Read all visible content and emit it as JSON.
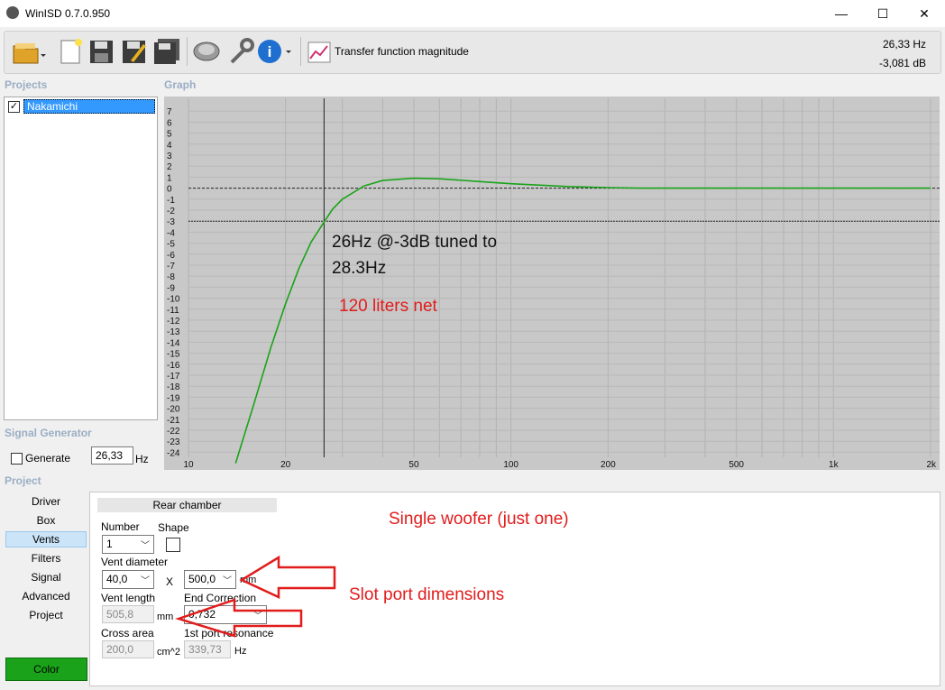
{
  "window": {
    "title": "WinISD 0.7.0.950",
    "minimize": "—",
    "maximize": "☐",
    "close": "✕"
  },
  "toolbar": {
    "graph_label": "Transfer function magnitude",
    "cursor_hz": "26,33 Hz",
    "cursor_db": "-3,081 dB",
    "icons": [
      "open-folder-icon",
      "new-document-icon",
      "save-icon",
      "save-as-icon",
      "save-all-icon",
      "driver-icon",
      "wrench-icon",
      "info-icon",
      "graph-icon"
    ]
  },
  "projects": {
    "heading": "Projects",
    "items": [
      {
        "label": "Nakamichi",
        "checked": true
      }
    ]
  },
  "graph": {
    "heading": "Graph",
    "y_ticks": [
      "7",
      "6",
      "5",
      "4",
      "3",
      "2",
      "1",
      "0",
      "-1",
      "-2",
      "-3",
      "-4",
      "-5",
      "-6",
      "-7",
      "-8",
      "-9",
      "-10",
      "-11",
      "-12",
      "-13",
      "-14",
      "-15",
      "-16",
      "-17",
      "-18",
      "-19",
      "-20",
      "-21",
      "-22",
      "-23",
      "-24"
    ],
    "x_ticks": [
      "10",
      "20",
      "50",
      "100",
      "200",
      "500",
      "1k",
      "2k"
    ],
    "annotation_1": "26Hz @-3dB tuned to",
    "annotation_2": "28.3Hz",
    "annotation_3": "120 liters net"
  },
  "chart_data": {
    "type": "line",
    "xscale": "log",
    "xlim": [
      10,
      2000
    ],
    "ylim": [
      -25,
      8
    ],
    "series": [
      {
        "color": "#1aa31a",
        "x": [
          14,
          16,
          18,
          20,
          22,
          24,
          26.3,
          28,
          30,
          35,
          40,
          50,
          60,
          80,
          100,
          150,
          200,
          250,
          500,
          1000,
          2000
        ],
        "y": [
          -25,
          -19.5,
          -14.5,
          -10.5,
          -7.3,
          -4.9,
          -3.1,
          -1.9,
          -1.0,
          0.2,
          0.7,
          0.9,
          0.85,
          0.6,
          0.4,
          0.15,
          0.05,
          0.0,
          0.0,
          0.0,
          0.0
        ]
      }
    ],
    "reference_lines": {
      "horizontal": [
        0,
        -3
      ],
      "vertical": [
        26.33
      ]
    }
  },
  "signal_generator": {
    "heading": "Signal Generator",
    "generate_label": "Generate",
    "frequency": "26,33",
    "unit": "Hz"
  },
  "project_nav": {
    "heading": "Project",
    "items": [
      "Driver",
      "Box",
      "Vents",
      "Filters",
      "Signal",
      "Advanced",
      "Project"
    ],
    "selected": "Vents",
    "color_button": "Color"
  },
  "vents_panel": {
    "section_title": "Rear chamber",
    "number_label": "Number",
    "number_value": "1",
    "shape_label": "Shape",
    "vent_diameter_label": "Vent diameter",
    "vent_diameter_value": "40,0",
    "x_label": "X",
    "vent_height_value": "500,0",
    "mm_unit": "mm",
    "vent_length_label": "Vent length",
    "vent_length_value": "505,8",
    "end_correction_label": "End Correction",
    "end_correction_value": "0,732",
    "cross_area_label": "Cross area",
    "cross_area_value": "200,0",
    "cross_area_unit": "cm^2",
    "port_resonance_label": "1st port resonance",
    "port_resonance_value": "339,73",
    "hz_unit": "Hz"
  },
  "annotations": {
    "single_woofer": "Single woofer (just one)",
    "slot_port": "Slot port dimensions"
  }
}
